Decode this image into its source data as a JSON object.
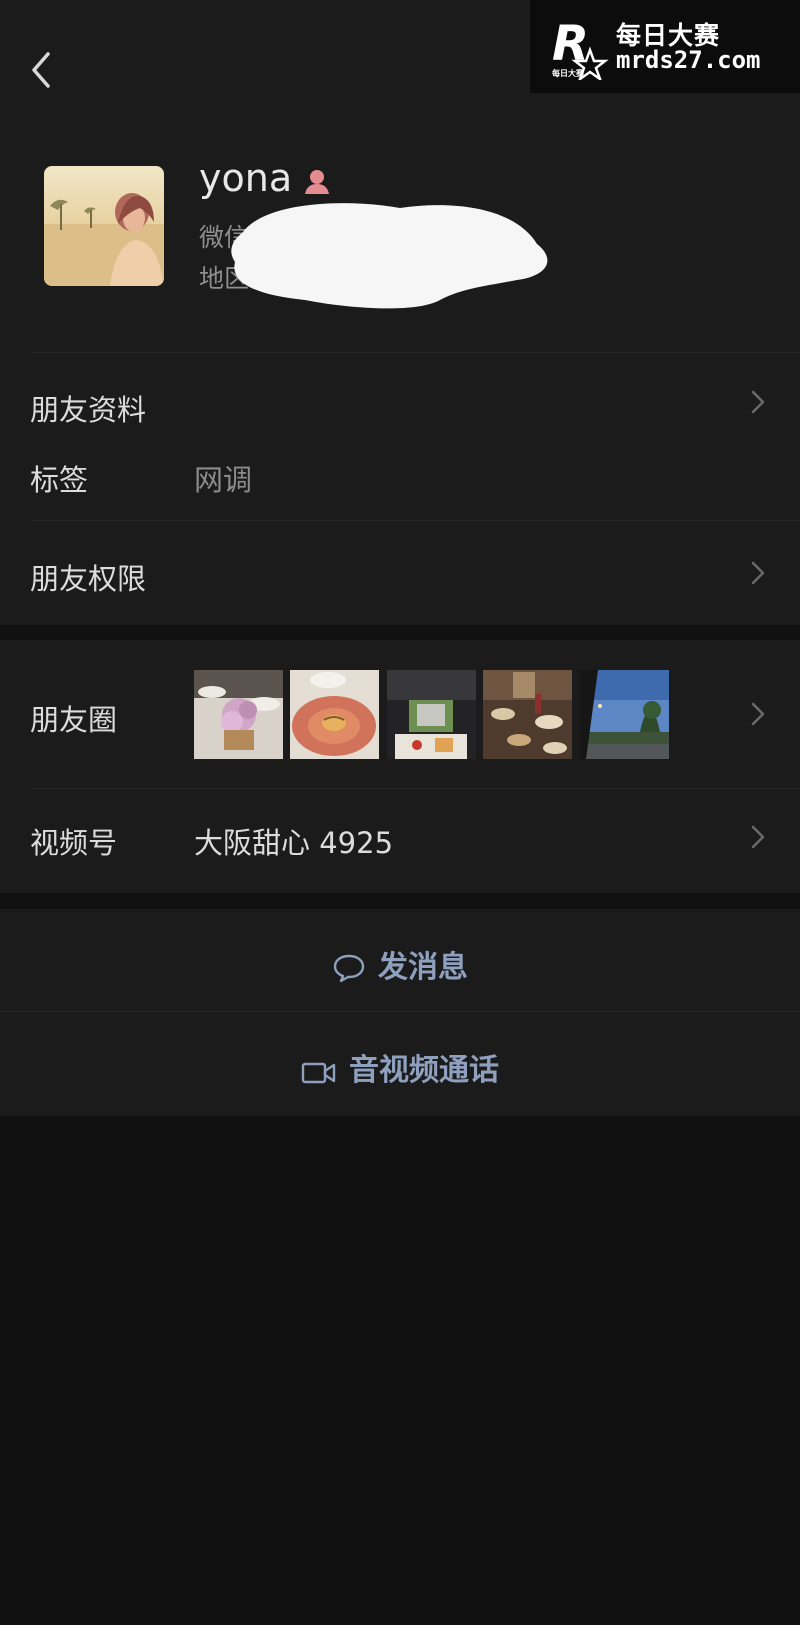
{
  "header": {
    "back_icon": "chevron-left-icon",
    "more_icon": "more-dots-icon"
  },
  "watermark": {
    "line1": "每日大赛",
    "line2": "mrds27.com",
    "logo_text": "每日大赛"
  },
  "profile": {
    "name": "yona",
    "gender_icon": "female-icon",
    "wechat_id_label": "微信号：",
    "region_label": "地区："
  },
  "info": {
    "friend_profile_label": "朋友资料",
    "tag_label": "标签",
    "tag_value": "网调",
    "permission_label": "朋友权限"
  },
  "moments": {
    "label": "朋友圈",
    "thumbnails": [
      "banquet-photo",
      "soup-photo",
      "car-meal-photo",
      "dinner-table-photo",
      "road-sky-photo"
    ]
  },
  "channels": {
    "label": "视频号",
    "value": "大阪甜心 4925"
  },
  "actions": {
    "message_label": "发消息",
    "call_label": "音视频通话"
  },
  "colors": {
    "background": "#111111",
    "panel": "#1b1b1b",
    "action_text": "#8ea0bd",
    "gender_icon": "#e58c90"
  }
}
